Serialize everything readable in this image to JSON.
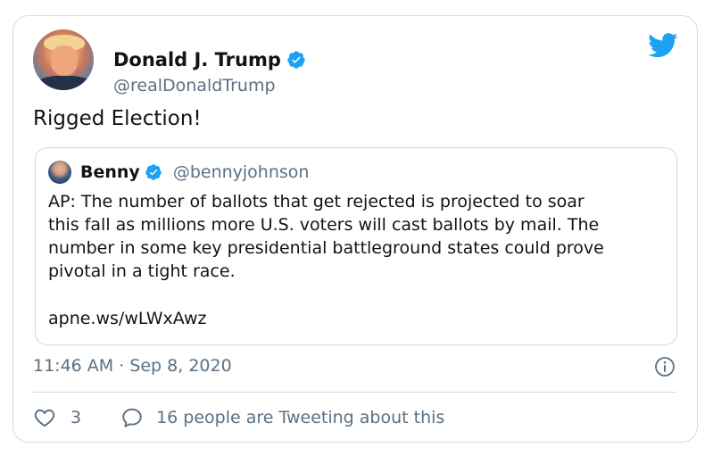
{
  "tweet": {
    "author": {
      "display_name": "Donald J. Trump",
      "handle": "@realDonaldTrump",
      "verified": true,
      "avatar": "profile-photo"
    },
    "text": "Rigged Election!",
    "quoted_tweet": {
      "author": {
        "display_name": "Benny",
        "handle": "@bennyjohnson",
        "verified": true
      },
      "text": "AP: The number of ballots that get rejected is projected to soar\nthis fall as millions more U.S. voters will cast ballots by mail. The\nnumber in some key presidential battleground states could prove\npivotal in a tight race.",
      "link": "apne.ws/wLWxAwz"
    },
    "timestamp": "11:46 AM · Sep 8, 2020",
    "actions": {
      "like_count": "3",
      "conversation_label": "16 people are Tweeting about this"
    }
  },
  "icons": {
    "brand": "twitter-bird-icon",
    "verified": "verified-badge-icon",
    "info": "info-icon",
    "like": "heart-icon",
    "reply": "speech-bubble-icon"
  },
  "colors": {
    "brand": "#1da1f2",
    "text": "#0f1419",
    "secondary_text": "#5b7083",
    "border": "#d4dbe1"
  }
}
